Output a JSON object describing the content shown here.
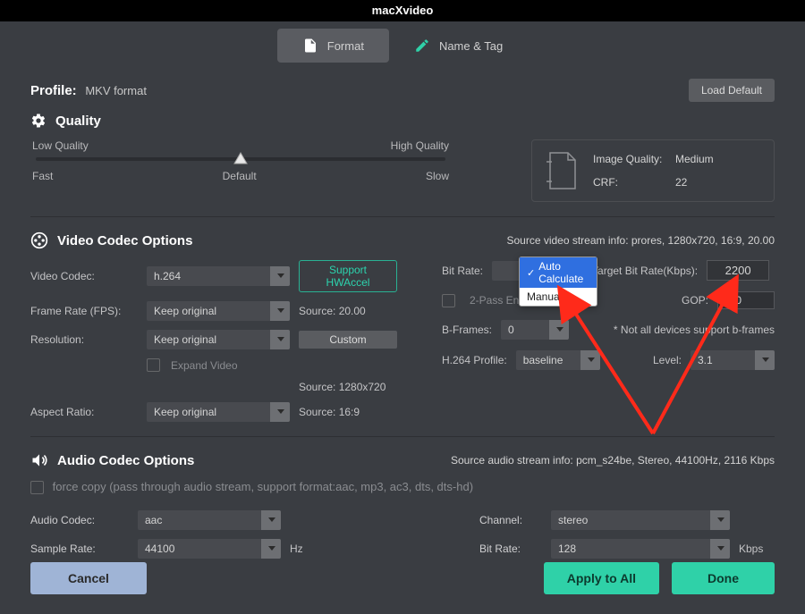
{
  "title": "macXvideo",
  "tabs": {
    "format": "Format",
    "nametag": "Name & Tag"
  },
  "profile": {
    "label": "Profile:",
    "value": "MKV format"
  },
  "load_default": "Load Default",
  "quality": {
    "heading": "Quality",
    "low": "Low Quality",
    "high": "High Quality",
    "fast": "Fast",
    "default": "Default",
    "slow": "Slow",
    "image_quality_label": "Image Quality:",
    "image_quality_value": "Medium",
    "crf_label": "CRF:",
    "crf_value": "22"
  },
  "video": {
    "heading": "Video Codec Options",
    "source_info": "Source video stream info: prores, 1280x720, 16:9, 20.00",
    "codec_label": "Video Codec:",
    "codec_value": "h.264",
    "hwaccel": "Support HWAccel",
    "fps_label": "Frame Rate (FPS):",
    "fps_value": "Keep original",
    "fps_src": "Source: 20.00",
    "res_label": "Resolution:",
    "res_value": "Keep original",
    "custom": "Custom",
    "expand": "Expand Video",
    "res_src": "Source: 1280x720",
    "ar_label": "Aspect Ratio:",
    "ar_value": "Keep original",
    "ar_src": "Source: 16:9",
    "bitrate_label": "Bit Rate:",
    "bitrate_options": {
      "auto": "Auto Calculate",
      "manual": "Manual"
    },
    "target_label": "Target Bit Rate(Kbps):",
    "target_value": "2200",
    "twopass": "2-Pass Encoding",
    "gop_label": "GOP:",
    "gop_value": "250",
    "bframes_label": "B-Frames:",
    "bframes_value": "0",
    "bframes_note": "* Not all devices support b-frames",
    "profile_label": "H.264 Profile:",
    "profile_value": "baseline",
    "level_label": "Level:",
    "level_value": "3.1"
  },
  "audio": {
    "heading": "Audio Codec Options",
    "source_info": "Source audio stream info: pcm_s24be, Stereo, 44100Hz, 2116 Kbps",
    "forcecopy": "force copy (pass through audio stream, support format:aac, mp3, ac3, dts, dts-hd)",
    "codec_label": "Audio Codec:",
    "codec_value": "aac",
    "samplerate_label": "Sample Rate:",
    "samplerate_value": "44100",
    "hz": "Hz",
    "channel_label": "Channel:",
    "channel_value": "stereo",
    "bitrate_label": "Bit Rate:",
    "bitrate_value": "128",
    "kbps": "Kbps"
  },
  "buttons": {
    "cancel": "Cancel",
    "apply": "Apply to All",
    "done": "Done"
  }
}
